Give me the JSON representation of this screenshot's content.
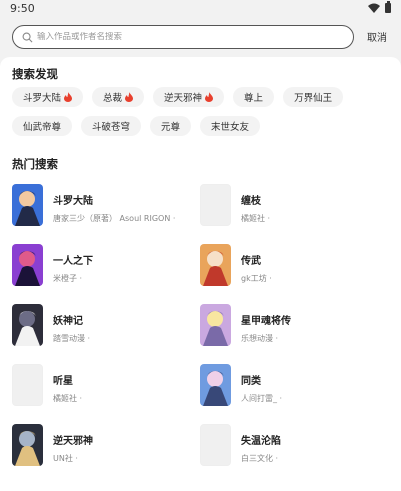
{
  "status_bar": {
    "time": "9:50",
    "icons": [
      "wifi-icon",
      "battery-icon"
    ]
  },
  "search": {
    "placeholder": "输入作品或作者名搜索",
    "value": "",
    "cancel_label": "取消"
  },
  "discover": {
    "title": "搜索发现",
    "rows": [
      [
        {
          "label": "斗罗大陆",
          "hot": true
        },
        {
          "label": "总裁",
          "hot": true
        },
        {
          "label": "逆天邪神",
          "hot": true
        },
        {
          "label": "尊上",
          "hot": false
        },
        {
          "label": "万界仙王",
          "hot": false
        }
      ],
      [
        {
          "label": "仙武帝尊",
          "hot": false
        },
        {
          "label": "斗破苍穹",
          "hot": false
        },
        {
          "label": "元尊",
          "hot": false
        },
        {
          "label": "末世女友",
          "hot": false
        }
      ]
    ]
  },
  "hot": {
    "title": "热门搜索",
    "items": [
      {
        "title": "斗罗大陆",
        "author": "唐家三少（原著） Asoul RIGON ·",
        "cover": "art"
      },
      {
        "title": "缠枝",
        "author": "橘姬社 ·",
        "cover": "plain"
      },
      {
        "title": "一人之下",
        "author": "米橙子 ·",
        "cover": "art"
      },
      {
        "title": "传武",
        "author": "gk工坊 ·",
        "cover": "art"
      },
      {
        "title": "妖神记",
        "author": "踏雪动漫 ·",
        "cover": "art"
      },
      {
        "title": "星甲魂将传",
        "author": "乐想动漫 ·",
        "cover": "art"
      },
      {
        "title": "听星",
        "author": "橘姬社 ·",
        "cover": "plain"
      },
      {
        "title": "同类",
        "author": "人间打雷_ ·",
        "cover": "art"
      },
      {
        "title": "逆天邪神",
        "author": "UN社 ·",
        "cover": "art"
      },
      {
        "title": "失温沦陷",
        "author": "白三文化 ·",
        "cover": "plain"
      }
    ]
  },
  "colors": {
    "hot_icon": "#e8402e",
    "card": "#ffffff",
    "background": "#f2f2f2"
  }
}
